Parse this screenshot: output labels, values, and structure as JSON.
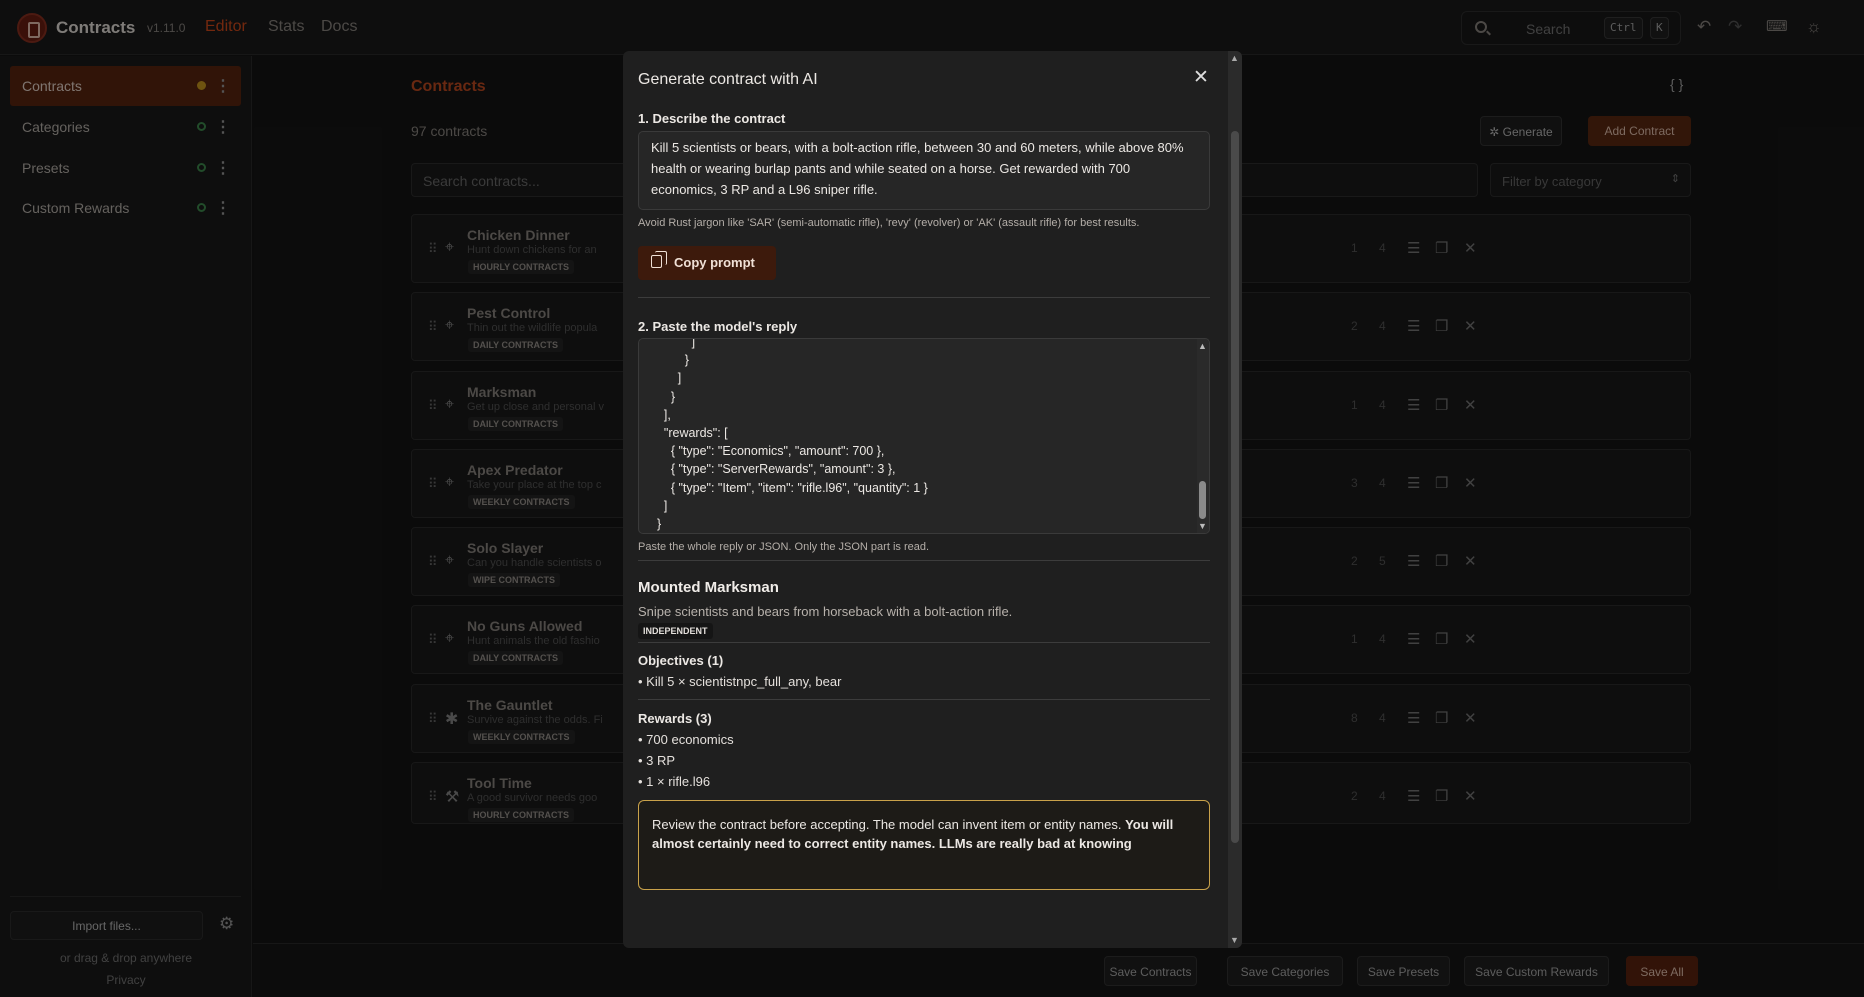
{
  "app": {
    "name": "Contracts",
    "version": "v1.11.0"
  },
  "nav": [
    "Editor",
    "Stats",
    "Docs"
  ],
  "search": {
    "placeholder": "Search",
    "kbd1": "Ctrl",
    "kbd2": "K"
  },
  "sidebar": {
    "items": [
      {
        "label": "Contracts",
        "status": "modified"
      },
      {
        "label": "Categories",
        "status": "saved"
      },
      {
        "label": "Presets",
        "status": "saved"
      },
      {
        "label": "Custom Rewards",
        "status": "saved"
      }
    ],
    "import_label": "Import files...",
    "drag_hint": "or drag & drop anywhere",
    "privacy": "Privacy"
  },
  "main": {
    "title": "Contracts",
    "count": "97 contracts",
    "braces": "{ }",
    "generate_label": "Generate",
    "add_label": "Add Contract",
    "search_placeholder": "Search contracts...",
    "filter_placeholder": "Filter by category",
    "cards": [
      {
        "title": "Chicken Dinner",
        "desc": "Hunt down chickens for an",
        "tag": "HOURLY CONTRACTS",
        "n1": "1",
        "n2": "4",
        "icon": "crosshair-icon"
      },
      {
        "title": "Pest Control",
        "desc": "Thin out the wildlife popula",
        "tag": "DAILY CONTRACTS",
        "n1": "2",
        "n2": "4",
        "icon": "crosshair-icon"
      },
      {
        "title": "Marksman",
        "desc": "Get up close and personal v",
        "tag": "DAILY CONTRACTS",
        "n1": "1",
        "n2": "4",
        "icon": "crosshair-icon"
      },
      {
        "title": "Apex Predator",
        "desc": "Take your place at the top c",
        "tag": "WEEKLY CONTRACTS",
        "n1": "3",
        "n2": "4",
        "icon": "crosshair-icon"
      },
      {
        "title": "Solo Slayer",
        "desc": "Can you handle scientists o",
        "tag": "WIPE CONTRACTS",
        "n1": "2",
        "n2": "5",
        "icon": "crosshair-icon"
      },
      {
        "title": "No Guns Allowed",
        "desc": "Hunt animals the old fashio",
        "tag": "DAILY CONTRACTS",
        "n1": "1",
        "n2": "4",
        "icon": "crosshair-icon"
      },
      {
        "title": "The Gauntlet",
        "desc": "Survive against the odds. Fi",
        "tag": "WEEKLY CONTRACTS",
        "n1": "8",
        "n2": "4",
        "icon": "asterisk-icon"
      },
      {
        "title": "Tool Time",
        "desc": "A good survivor needs goo",
        "tag": "HOURLY CONTRACTS",
        "n1": "2",
        "n2": "4",
        "icon": "wrench-icon"
      }
    ]
  },
  "footer": [
    "Save Contracts",
    "Save Categories",
    "Save Presets",
    "Save Custom Rewards",
    "Save All"
  ],
  "modal": {
    "title": "Generate contract with AI",
    "step1": "1. Describe the contract",
    "description": "Kill 5 scientists or bears, with a bolt-action rifle, between 30 and 60 meters, while above 80% health or wearing burlap pants and while seated on a horse. Get rewarded with 700 economics, 3 RP and a L96 sniper rifle.",
    "hint1": "Avoid Rust jargon like 'SAR' (semi-automatic rifle), 'revy' (revolver) or 'AK' (assault rifle) for best results.",
    "copy_label": "Copy prompt",
    "step2": "2. Paste the model's reply",
    "json_reply": "            ]\n          }\n        ]\n      }\n    ],\n    \"rewards\": [\n      { \"type\": \"Economics\", \"amount\": 700 },\n      { \"type\": \"ServerRewards\", \"amount\": 3 },\n      { \"type\": \"Item\", \"item\": \"rifle.l96\", \"quantity\": 1 }\n    ]\n  }",
    "hint2": "Paste the whole reply or JSON. Only the JSON part is read.",
    "preview": {
      "title": "Mounted Marksman",
      "desc": "Snipe scientists and bears from horseback with a bolt-action rifle.",
      "badge": "INDEPENDENT",
      "objectives_title": "Objectives (1)",
      "objectives": [
        "• Kill 5 × scientistnpc_full_any, bear"
      ],
      "rewards_title": "Rewards (3)",
      "rewards": [
        "• 700 economics",
        "• 3 RP",
        "• 1 × rifle.l96"
      ]
    },
    "warning_plain": "Review the contract before accepting. The model can invent item or entity names. ",
    "warning_bold": "You will almost certainly need to correct entity names. LLMs are really bad at knowing"
  },
  "colors": {
    "accent": "#d24a1a",
    "primary_button": "#5c2410",
    "saved_dot": "#3e8a4e",
    "modified_dot": "#c9971e",
    "warning_border": "#c9a24a"
  }
}
